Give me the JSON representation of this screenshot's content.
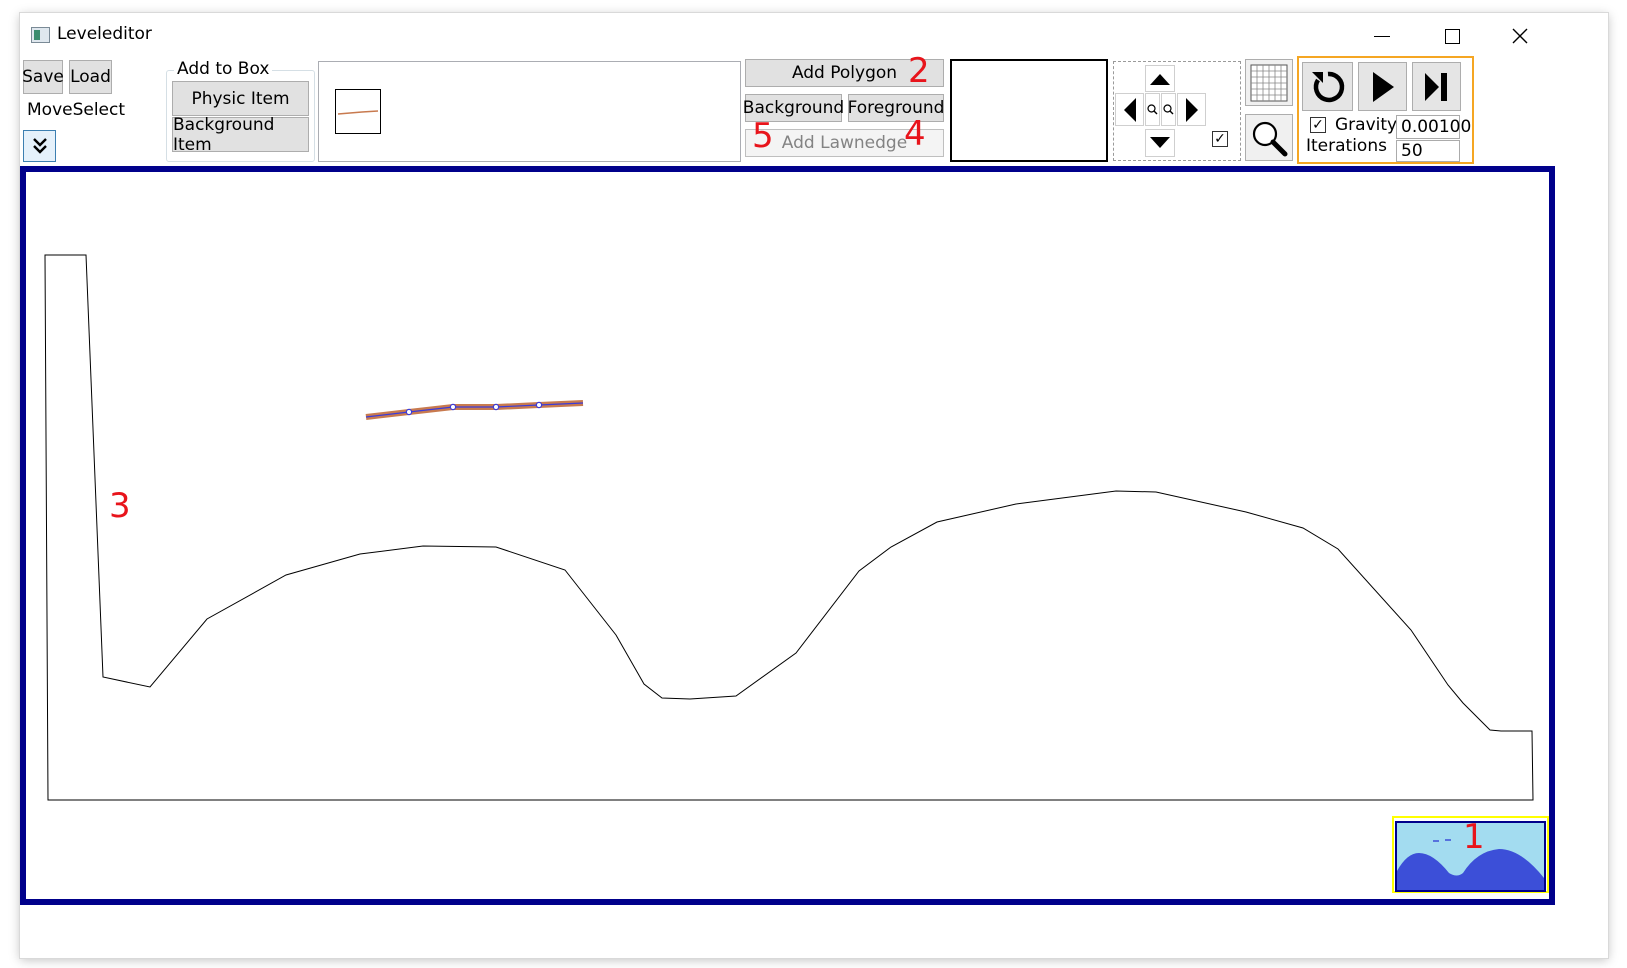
{
  "window": {
    "title": "Leveleditor",
    "controls": {
      "minimize": "—",
      "maximize": "☐",
      "close": "✕"
    }
  },
  "toolbar": {
    "save_label": "Save",
    "load_label": "Load",
    "mode_label": "MoveSelect",
    "add_to_box": {
      "legend": "Add to Box",
      "physic_item": "Physic Item",
      "background_item": "Background Item"
    },
    "polygon": {
      "add_polygon": "Add Polygon",
      "background": "Background",
      "foreground": "Foreground",
      "add_lawnedge": "Add Lawnedge"
    },
    "simulation": {
      "gravity_label": "Gravity",
      "gravity_checked": true,
      "gravity_value": "0.00100",
      "iterations_label": "Iterations",
      "iterations_value": "50"
    },
    "nav_checkbox_checked": true
  },
  "annotations": {
    "n1": "1",
    "n2": "2",
    "n3": "3",
    "n4": "4",
    "n5": "5"
  },
  "colors": {
    "canvas_border": "#00008b",
    "annotation_red": "#e8141b",
    "simulation_border": "#f5a623",
    "minimap_border": "#ffff00",
    "minimap_sky": "#a3dcf0",
    "minimap_ground": "#3c4fd8",
    "edge_orange": "#c87a4f"
  }
}
